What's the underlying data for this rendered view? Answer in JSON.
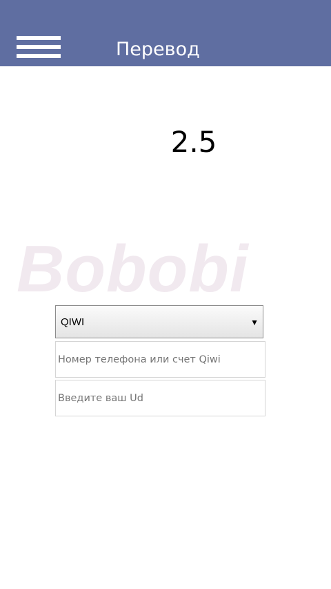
{
  "header": {
    "title": "Перевод",
    "menu_icon": "hamburger-menu-icon",
    "background_color": "#5f6ea1"
  },
  "balance": {
    "value": "2.5"
  },
  "watermark": {
    "text": "Bobobi"
  },
  "form": {
    "payment_method": {
      "selected": "QIWI",
      "arrow_icon": "dropdown-arrow-icon"
    },
    "phone_field": {
      "placeholder": "Номер телефона или счет Qiwi",
      "value": ""
    },
    "id_field": {
      "placeholder": "Введите ваш Ud",
      "value": ""
    }
  }
}
